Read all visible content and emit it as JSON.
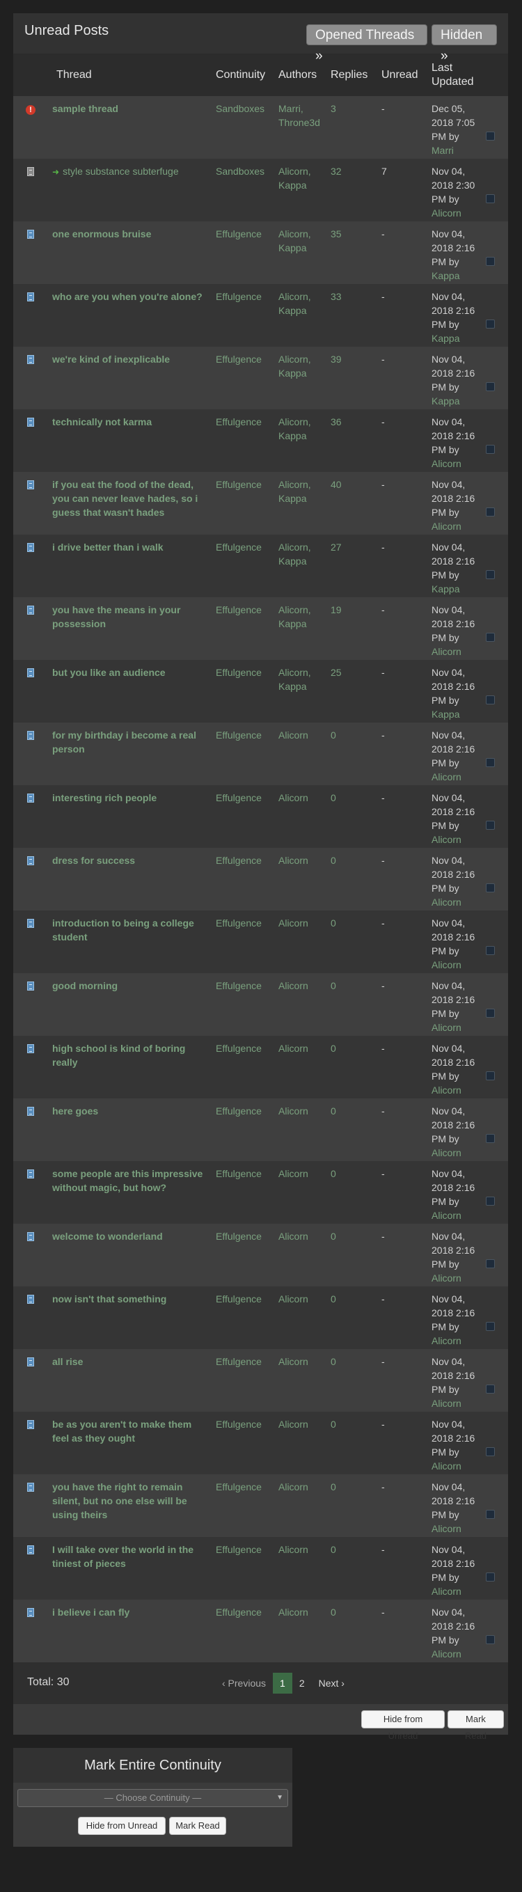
{
  "header": {
    "title": "Unread Posts",
    "opened_threads_label": "Opened Threads »",
    "hidden_label": "Hidden »"
  },
  "columns": {
    "thread": "Thread",
    "continuity": "Continuity",
    "authors": "Authors",
    "replies": "Replies",
    "unread": "Unread",
    "last_updated": "Last Updated"
  },
  "threads": [
    {
      "icon": "alert-icon",
      "title": "sample thread",
      "continuity": "Sandboxes",
      "authors": "Marri, Throne3d",
      "replies": "3",
      "unread": "-",
      "date": "Dec 05, 2018 7:05 PM by",
      "by": "Marri"
    },
    {
      "icon": "doc-grey-icon",
      "title": "style substance subterfuge",
      "continuity": "Sandboxes",
      "authors": "Alicorn, Kappa",
      "replies": "32",
      "unread": "7",
      "date": "Nov 04, 2018 2:30 PM by",
      "by": "Alicorn"
    },
    {
      "icon": "doc-icon",
      "title": "one enormous bruise",
      "continuity": "Effulgence",
      "authors": "Alicorn, Kappa",
      "replies": "35",
      "unread": "-",
      "date": "Nov 04, 2018 2:16 PM by",
      "by": "Kappa"
    },
    {
      "icon": "doc-icon",
      "title": "who are you when you're alone?",
      "continuity": "Effulgence",
      "authors": "Alicorn, Kappa",
      "replies": "33",
      "unread": "-",
      "date": "Nov 04, 2018 2:16 PM by",
      "by": "Kappa"
    },
    {
      "icon": "doc-icon",
      "title": "we're kind of inexplicable",
      "continuity": "Effulgence",
      "authors": "Alicorn, Kappa",
      "replies": "39",
      "unread": "-",
      "date": "Nov 04, 2018 2:16 PM by",
      "by": "Kappa"
    },
    {
      "icon": "doc-icon",
      "title": "technically not karma",
      "continuity": "Effulgence",
      "authors": "Alicorn, Kappa",
      "replies": "36",
      "unread": "-",
      "date": "Nov 04, 2018 2:16 PM by",
      "by": "Alicorn"
    },
    {
      "icon": "doc-icon",
      "title": "if you eat the food of the dead, you can never leave hades, so i guess that wasn't hades",
      "continuity": "Effulgence",
      "authors": "Alicorn, Kappa",
      "replies": "40",
      "unread": "-",
      "date": "Nov 04, 2018 2:16 PM by",
      "by": "Alicorn"
    },
    {
      "icon": "doc-icon",
      "title": "i drive better than i walk",
      "continuity": "Effulgence",
      "authors": "Alicorn, Kappa",
      "replies": "27",
      "unread": "-",
      "date": "Nov 04, 2018 2:16 PM by",
      "by": "Kappa"
    },
    {
      "icon": "doc-icon",
      "title": "you have the means in your possession",
      "continuity": "Effulgence",
      "authors": "Alicorn, Kappa",
      "replies": "19",
      "unread": "-",
      "date": "Nov 04, 2018 2:16 PM by",
      "by": "Alicorn"
    },
    {
      "icon": "doc-icon",
      "title": "but you like an audience",
      "continuity": "Effulgence",
      "authors": "Alicorn, Kappa",
      "replies": "25",
      "unread": "-",
      "date": "Nov 04, 2018 2:16 PM by",
      "by": "Kappa"
    },
    {
      "icon": "doc-icon",
      "title": "for my birthday i become a real person",
      "continuity": "Effulgence",
      "authors": "Alicorn",
      "replies": "0",
      "unread": "-",
      "date": "Nov 04, 2018 2:16 PM by",
      "by": "Alicorn"
    },
    {
      "icon": "doc-icon",
      "title": "interesting rich people",
      "continuity": "Effulgence",
      "authors": "Alicorn",
      "replies": "0",
      "unread": "-",
      "date": "Nov 04, 2018 2:16 PM by",
      "by": "Alicorn"
    },
    {
      "icon": "doc-icon",
      "title": "dress for success",
      "continuity": "Effulgence",
      "authors": "Alicorn",
      "replies": "0",
      "unread": "-",
      "date": "Nov 04, 2018 2:16 PM by",
      "by": "Alicorn"
    },
    {
      "icon": "doc-icon",
      "title": "introduction to being a college student",
      "continuity": "Effulgence",
      "authors": "Alicorn",
      "replies": "0",
      "unread": "-",
      "date": "Nov 04, 2018 2:16 PM by",
      "by": "Alicorn"
    },
    {
      "icon": "doc-icon",
      "title": "good morning",
      "continuity": "Effulgence",
      "authors": "Alicorn",
      "replies": "0",
      "unread": "-",
      "date": "Nov 04, 2018 2:16 PM by",
      "by": "Alicorn"
    },
    {
      "icon": "doc-icon",
      "title": "high school is kind of boring really",
      "continuity": "Effulgence",
      "authors": "Alicorn",
      "replies": "0",
      "unread": "-",
      "date": "Nov 04, 2018 2:16 PM by",
      "by": "Alicorn"
    },
    {
      "icon": "doc-icon",
      "title": "here goes",
      "continuity": "Effulgence",
      "authors": "Alicorn",
      "replies": "0",
      "unread": "-",
      "date": "Nov 04, 2018 2:16 PM by",
      "by": "Alicorn"
    },
    {
      "icon": "doc-icon",
      "title": "some people are this impressive without magic, but how?",
      "continuity": "Effulgence",
      "authors": "Alicorn",
      "replies": "0",
      "unread": "-",
      "date": "Nov 04, 2018 2:16 PM by",
      "by": "Alicorn"
    },
    {
      "icon": "doc-icon",
      "title": "welcome to wonderland",
      "continuity": "Effulgence",
      "authors": "Alicorn",
      "replies": "0",
      "unread": "-",
      "date": "Nov 04, 2018 2:16 PM by",
      "by": "Alicorn"
    },
    {
      "icon": "doc-icon",
      "title": "now isn't that something",
      "continuity": "Effulgence",
      "authors": "Alicorn",
      "replies": "0",
      "unread": "-",
      "date": "Nov 04, 2018 2:16 PM by",
      "by": "Alicorn"
    },
    {
      "icon": "doc-icon",
      "title": "all rise",
      "continuity": "Effulgence",
      "authors": "Alicorn",
      "replies": "0",
      "unread": "-",
      "date": "Nov 04, 2018 2:16 PM by",
      "by": "Alicorn"
    },
    {
      "icon": "doc-icon",
      "title": "be as you aren't to make them feel as they ought",
      "continuity": "Effulgence",
      "authors": "Alicorn",
      "replies": "0",
      "unread": "-",
      "date": "Nov 04, 2018 2:16 PM by",
      "by": "Alicorn"
    },
    {
      "icon": "doc-icon",
      "title": "you have the right to remain silent, but no one else will be using theirs",
      "continuity": "Effulgence",
      "authors": "Alicorn",
      "replies": "0",
      "unread": "-",
      "date": "Nov 04, 2018 2:16 PM by",
      "by": "Alicorn"
    },
    {
      "icon": "doc-icon",
      "title": "I will take over the world in the tiniest of pieces",
      "continuity": "Effulgence",
      "authors": "Alicorn",
      "replies": "0",
      "unread": "-",
      "date": "Nov 04, 2018 2:16 PM by",
      "by": "Alicorn"
    },
    {
      "icon": "doc-icon",
      "title": "i believe i can fly",
      "continuity": "Effulgence",
      "authors": "Alicorn",
      "replies": "0",
      "unread": "-",
      "date": "Nov 04, 2018 2:16 PM by",
      "by": "Alicorn"
    }
  ],
  "footer": {
    "total": "Total: 30",
    "prev_label": "‹ Previous",
    "pages": [
      "1",
      "2"
    ],
    "current_page": "1",
    "next_label": "Next ›"
  },
  "actions": {
    "hide_from_unread": "Hide from Unread",
    "mark_read": "Mark Read"
  },
  "mark_continuity": {
    "title": "Mark Entire Continuity",
    "select_value": "— Choose Continuity —",
    "hide_from_unread": "Hide from Unread",
    "mark_read": "Mark Read"
  },
  "colors": {
    "link": "#7aa07e",
    "active_page": "#3c6b45",
    "background": "#202020"
  }
}
